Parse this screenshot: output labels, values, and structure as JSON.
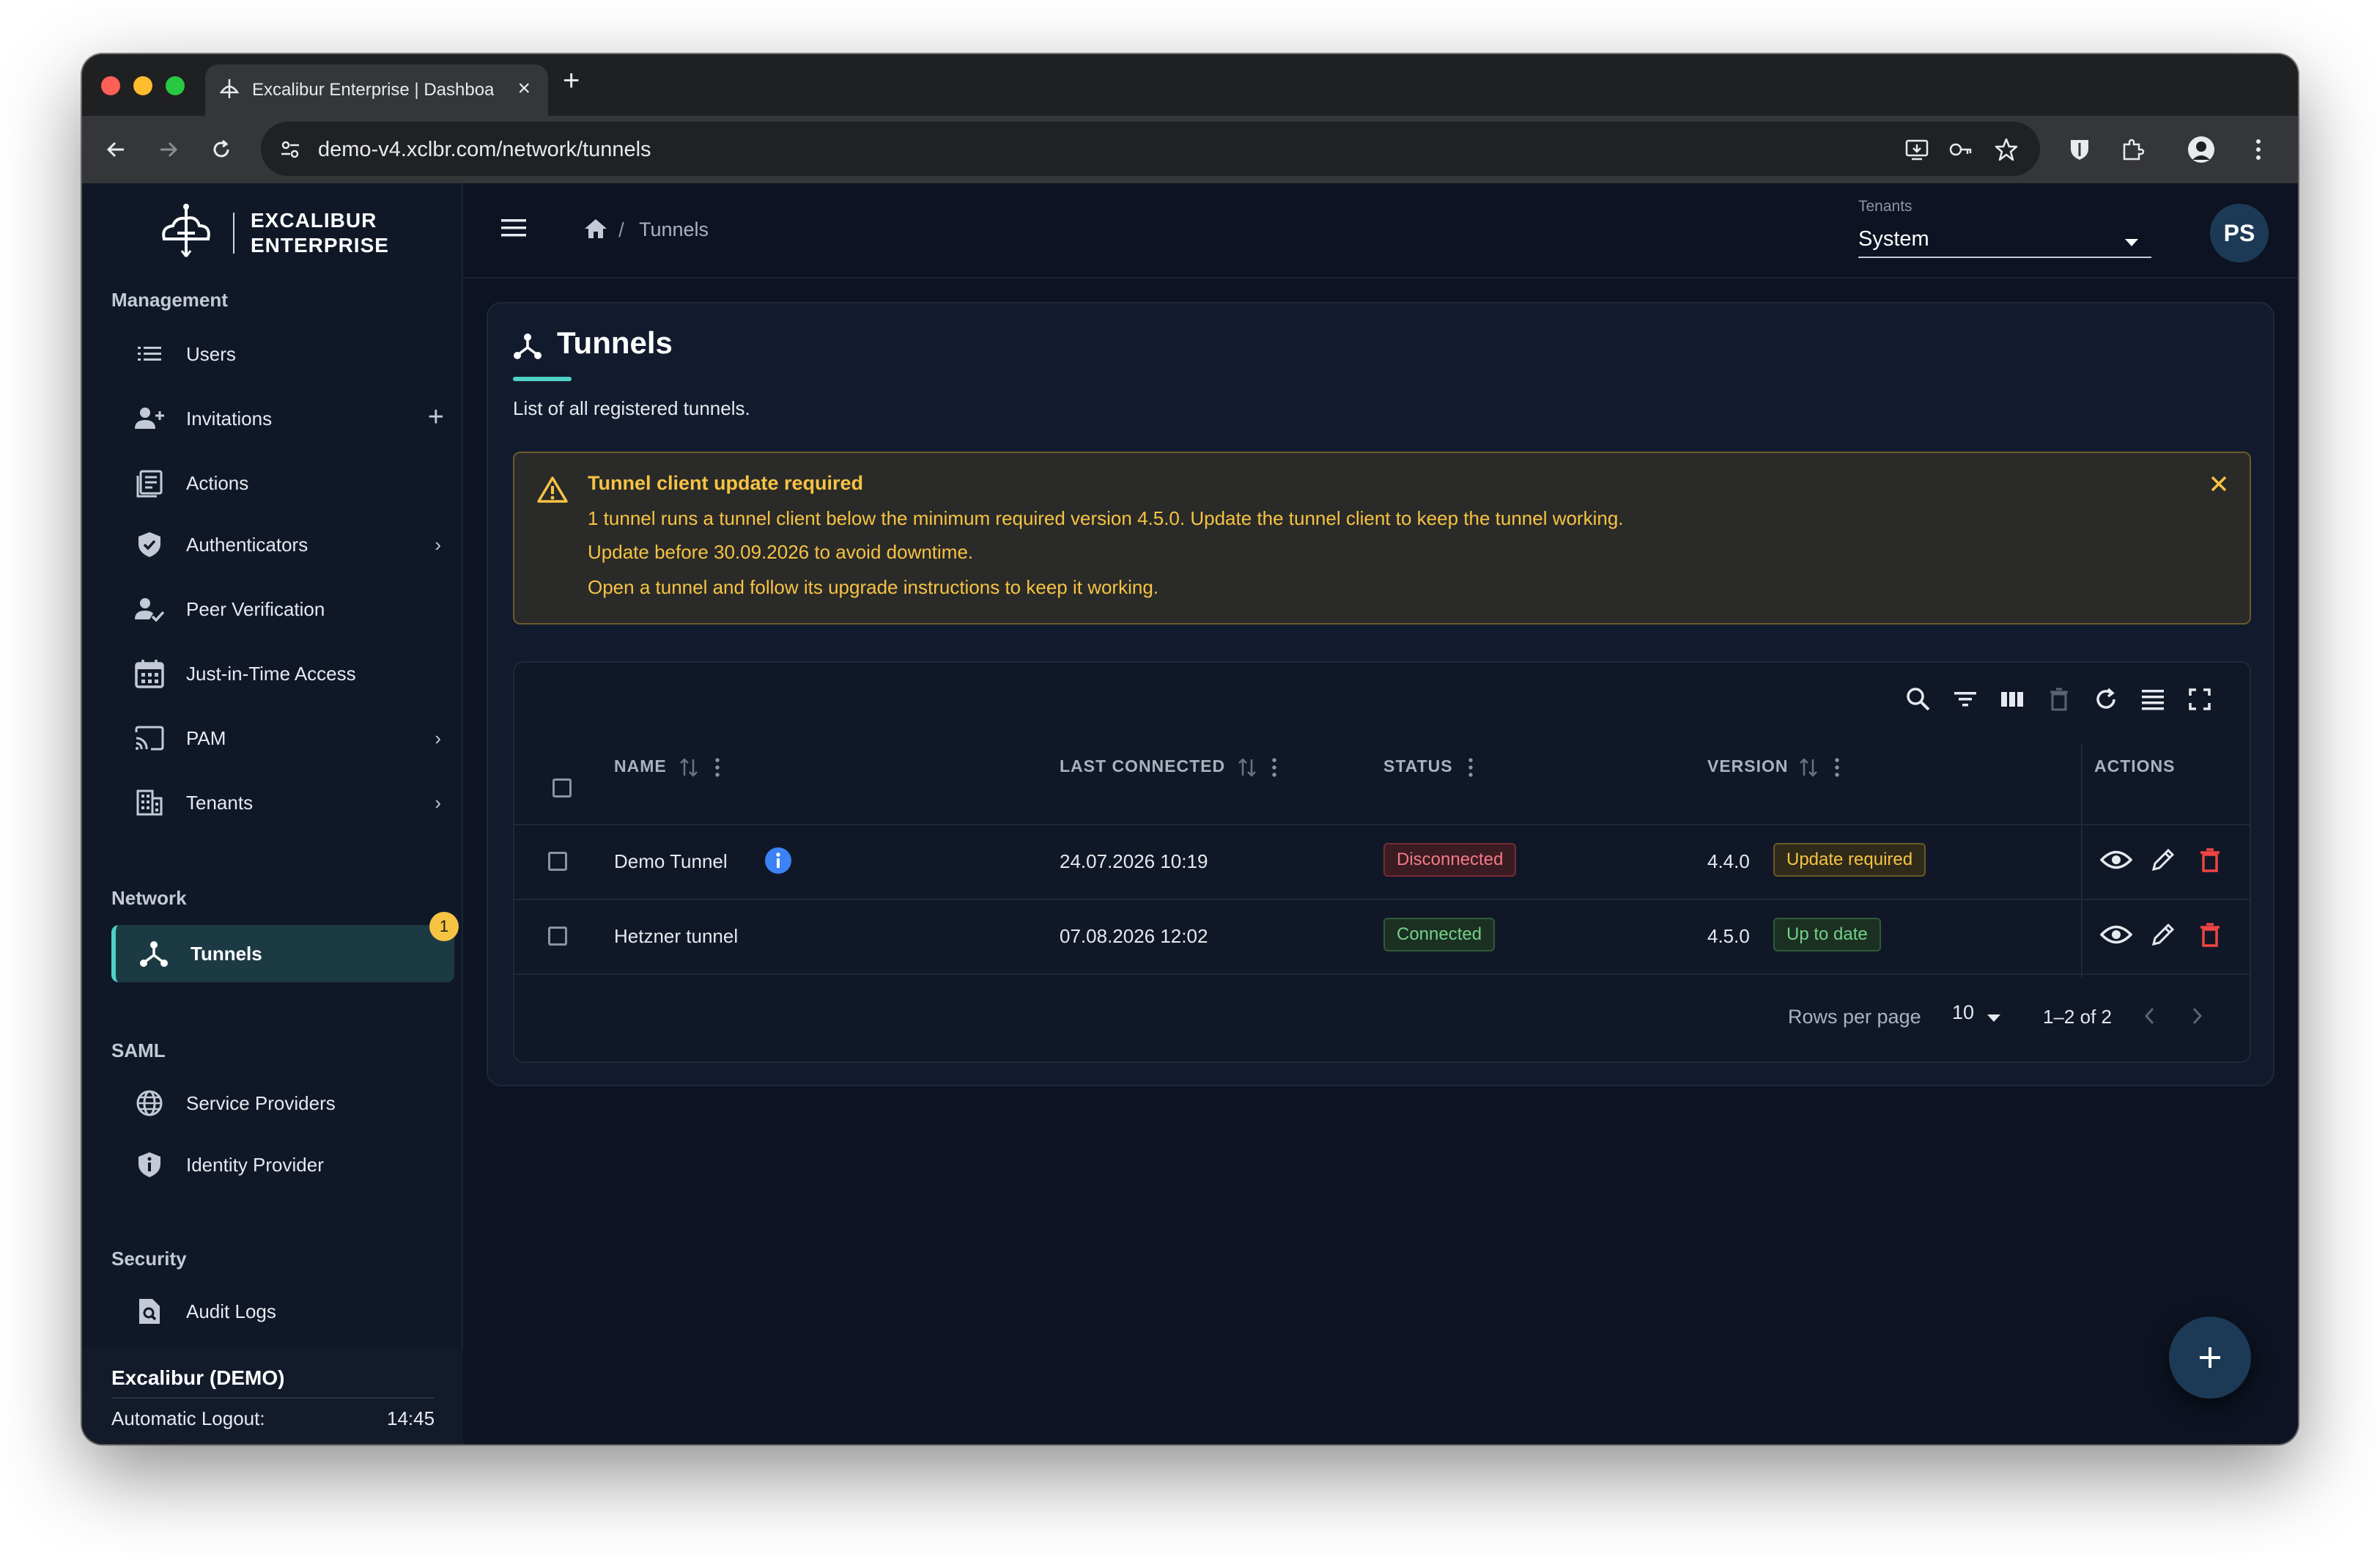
{
  "browser": {
    "tab_title": "Excalibur Enterprise | Dashboard",
    "url": "demo-v4.xclbr.com/network/tunnels",
    "new_tab_label": "+"
  },
  "brand": {
    "line1": "EXCALIBUR",
    "line2": "ENTERPRISE"
  },
  "sidebar": {
    "sections": {
      "management": "Management",
      "network": "Network",
      "saml": "SAML",
      "security": "Security"
    },
    "items": {
      "users": "Users",
      "invitations": "Invitations",
      "actions": "Actions",
      "authenticators": "Authenticators",
      "peer_verification": "Peer Verification",
      "jit_access": "Just-in-Time Access",
      "pam": "PAM",
      "tenants": "Tenants",
      "tunnels": "Tunnels",
      "service_providers": "Service Providers",
      "identity_provider": "Identity Provider",
      "audit_logs": "Audit Logs"
    },
    "tunnels_badge": "1",
    "footer": {
      "title": "Excalibur (DEMO)",
      "logout_label": "Automatic Logout:",
      "logout_time": "14:45"
    }
  },
  "header": {
    "breadcrumb_sep": "/",
    "breadcrumb": "Tunnels",
    "tenant_label": "Tenants",
    "tenant_value": "System",
    "avatar_initials": "PS"
  },
  "page": {
    "title": "Tunnels",
    "subtitle": "List of all registered tunnels."
  },
  "alert": {
    "title": "Tunnel client update required",
    "lines": [
      "1 tunnel runs a tunnel client below the minimum required version 4.5.0. Update the tunnel client to keep the tunnel working.",
      "Update before 30.09.2026 to avoid downtime.",
      "Open a tunnel and follow its upgrade instructions to keep it working."
    ]
  },
  "table": {
    "columns": {
      "name": "NAME",
      "last_connected": "LAST CONNECTED",
      "status": "STATUS",
      "version": "VERSION",
      "actions": "ACTIONS"
    },
    "rows": [
      {
        "name": "Demo Tunnel",
        "last_connected": "24.07.2026 10:19",
        "status": "Disconnected",
        "version": "4.4.0",
        "version_status": "Update required"
      },
      {
        "name": "Hetzner tunnel",
        "last_connected": "07.08.2026 12:02",
        "status": "Connected",
        "version": "4.5.0",
        "version_status": "Up to date"
      }
    ],
    "pagination": {
      "rows_per_page_label": "Rows per page",
      "rows_per_page": "10",
      "range": "1–2 of 2"
    }
  },
  "colors": {
    "accent": "#4fd1c5",
    "warning": "#f6c343",
    "danger": "#f27a86",
    "success": "#74d089",
    "info": "#3b82f6"
  }
}
